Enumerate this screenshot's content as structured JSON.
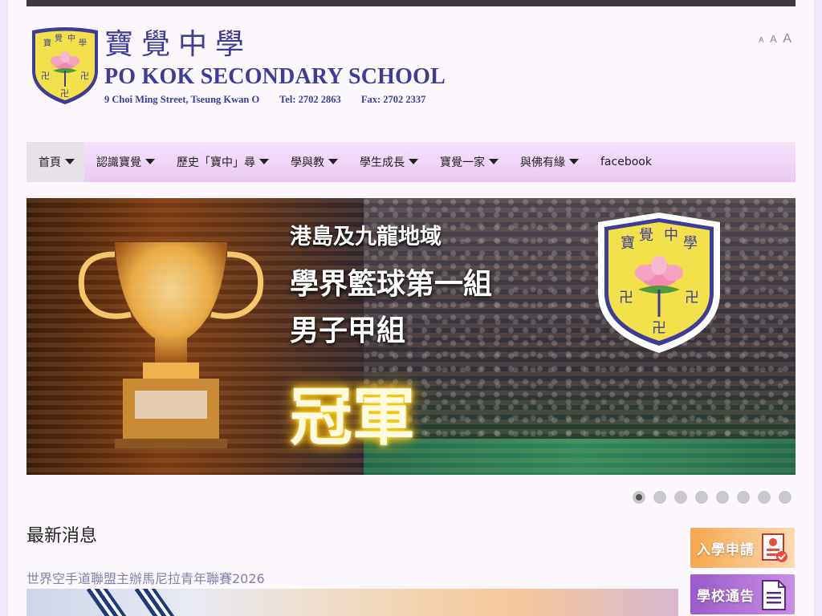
{
  "header": {
    "title_zh": "寶覺中學",
    "title_en": "PO KOK SECONDARY SCHOOL",
    "address": "9 Choi Ming Street, Tseung Kwan O",
    "tel": "Tel: 2702 2863",
    "fax": "Fax: 2702 2337",
    "crest_chars": [
      "寶",
      "覺",
      "中",
      "學"
    ],
    "font_size_controls": [
      "A",
      "A",
      "A"
    ]
  },
  "nav": {
    "items": [
      {
        "label": "首頁",
        "dropdown": true,
        "active": true
      },
      {
        "label": "認識寶覺",
        "dropdown": true
      },
      {
        "label": "歷史「寶中」尋",
        "dropdown": true
      },
      {
        "label": "學與教",
        "dropdown": true
      },
      {
        "label": "學生成長",
        "dropdown": true
      },
      {
        "label": "寶覺一家",
        "dropdown": true
      },
      {
        "label": "與佛有緣",
        "dropdown": true
      },
      {
        "label": "facebook",
        "dropdown": false
      }
    ]
  },
  "banner": {
    "line1": "港島及九龍地域",
    "line2": "學界籃球第一組",
    "line3": "男子甲組",
    "line4": "冠軍",
    "slide_count": 8,
    "active_slide": 1
  },
  "news": {
    "heading": "最新消息",
    "first_title": "世界空手道聯盟主辦馬尼拉青年聯賽2026"
  },
  "side": {
    "apply_label": "入學申請",
    "notice_label": "學校通告"
  },
  "colors": {
    "brand": "#3e3c98",
    "nav_bg": "#eac9f4",
    "page_bg": "#f3e6f8",
    "link": "#7f7fb0",
    "crest_yellow": "#f2e14a"
  }
}
